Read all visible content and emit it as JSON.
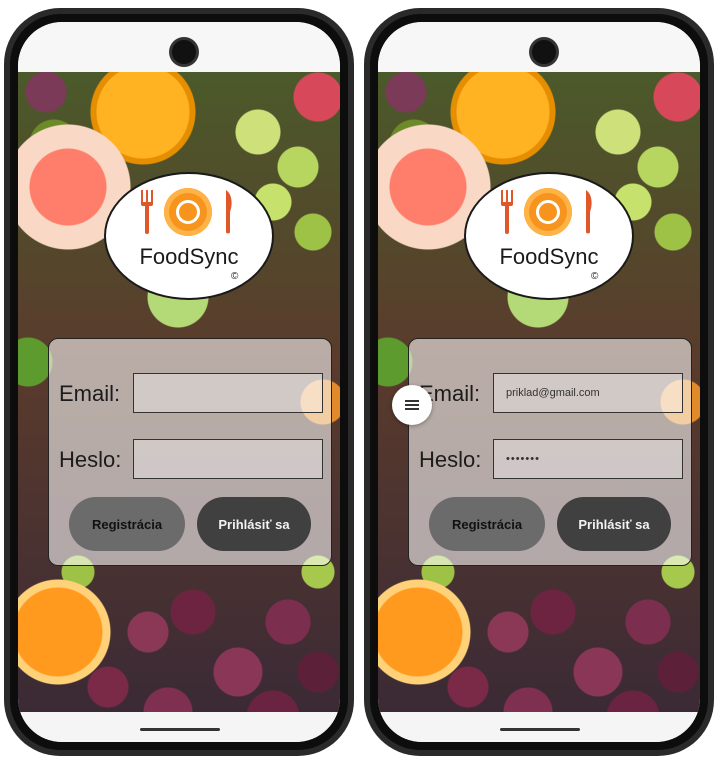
{
  "app": {
    "name": "FoodSync",
    "copyright_symbol": "©"
  },
  "colors": {
    "accent": "#f7941d",
    "login_button": "#404040",
    "register_button": "#6b6b6b"
  },
  "screens": [
    {
      "email_label": "Email:",
      "password_label": "Heslo:",
      "email_value": "",
      "password_value": "",
      "register_label": "Registrácia",
      "login_label": "Prihlásiť sa"
    },
    {
      "email_label": "Email:",
      "password_label": "Heslo:",
      "email_value": "priklad@gmail.com",
      "password_value": "•••••••",
      "register_label": "Registrácia",
      "login_label": "Prihlásiť sa"
    }
  ],
  "floating_menu": {
    "icon": "menu-icon"
  }
}
